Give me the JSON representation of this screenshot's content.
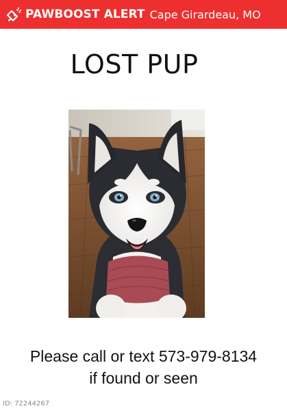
{
  "banner": {
    "brand": "PAWBOOST ALERT",
    "location": "Cape Girardeau, MO",
    "icon": "megaphone-paw-icon",
    "color": "#ee2f2f"
  },
  "headline": "LOST PUP",
  "photo": {
    "subject": "husky-puppy-photo"
  },
  "message": {
    "line1": "Please call or text 573-979-8134",
    "line2": "if found or seen"
  },
  "alert_id": "ID: 72244267"
}
